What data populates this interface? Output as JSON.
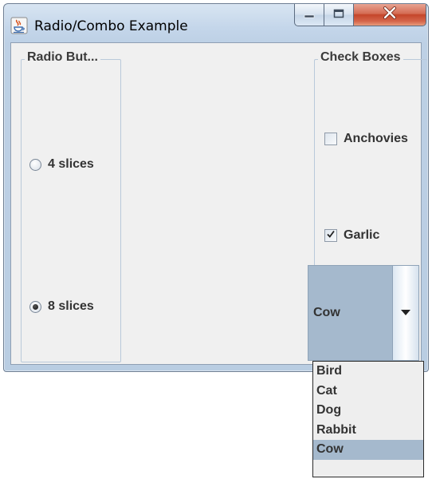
{
  "window": {
    "title": "Radio/Combo Example",
    "minimize_icon": "minimize-icon",
    "maximize_icon": "maximize-icon",
    "close_icon": "close-icon",
    "app_icon": "java-icon"
  },
  "radio_group": {
    "legend": "Radio But...",
    "options": [
      {
        "label": "4 slices",
        "selected": false
      },
      {
        "label": "8 slices",
        "selected": true
      }
    ]
  },
  "check_group": {
    "legend": "Check Boxes",
    "options": [
      {
        "label": "Anchovies",
        "checked": false
      },
      {
        "label": "Garlic",
        "checked": true
      }
    ]
  },
  "combo": {
    "selected": "Cow",
    "arrow_icon": "chevron-down-icon",
    "options": [
      "Bird",
      "Cat",
      "Dog",
      "Rabbit",
      "Cow"
    ]
  },
  "colors": {
    "selection": "#a5b9cd",
    "close_button": "#c4452a",
    "panel_background": "#f0f0f0"
  }
}
